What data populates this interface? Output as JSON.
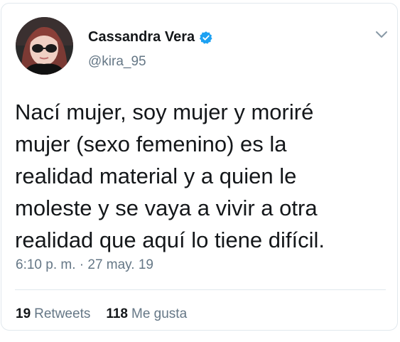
{
  "tweet": {
    "author": {
      "name": "Cassandra Vera",
      "handle": "@kira_95",
      "verified": true,
      "avatar_icon": "profile-photo-woman-sunglasses"
    },
    "text": "Nací mujer, soy mujer y moriré\nmujer (sexo femenino) es la\nrealidad material y a quien le\nmoleste y se vaya a vivir a otra\nrealidad que aquí lo tiene difícil.",
    "timestamp": "6:10 p. m. · 27 may. 19",
    "stats": {
      "retweets_count": "19",
      "retweets_label": "Retweets",
      "likes_count": "118",
      "likes_label": "Me gusta"
    }
  },
  "colors": {
    "text": "#14171a",
    "secondary": "#657786",
    "verified_blue": "#1da1f2",
    "border": "#e1e8ed"
  }
}
